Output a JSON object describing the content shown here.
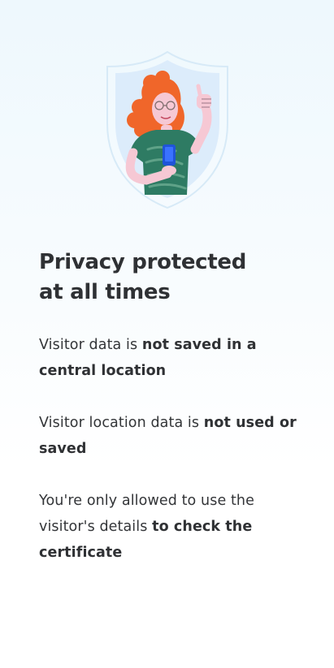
{
  "title": {
    "line1": "Privacy protected",
    "line2": "at all times"
  },
  "paragraphs": [
    {
      "text": "Visitor data is ",
      "bold": "not saved in a central location"
    },
    {
      "text": "Visitor location data is ",
      "bold": "not used or saved"
    },
    {
      "text": "You're only allowed to use the visitor's details ",
      "bold": "to check the certificate"
    }
  ],
  "colors": {
    "shield": "#dcecfb",
    "hair": "#f0662a",
    "shirt": "#2e7b63",
    "skin": "#f6c8d4",
    "phone": "#1f54d8",
    "text": "#333538"
  }
}
